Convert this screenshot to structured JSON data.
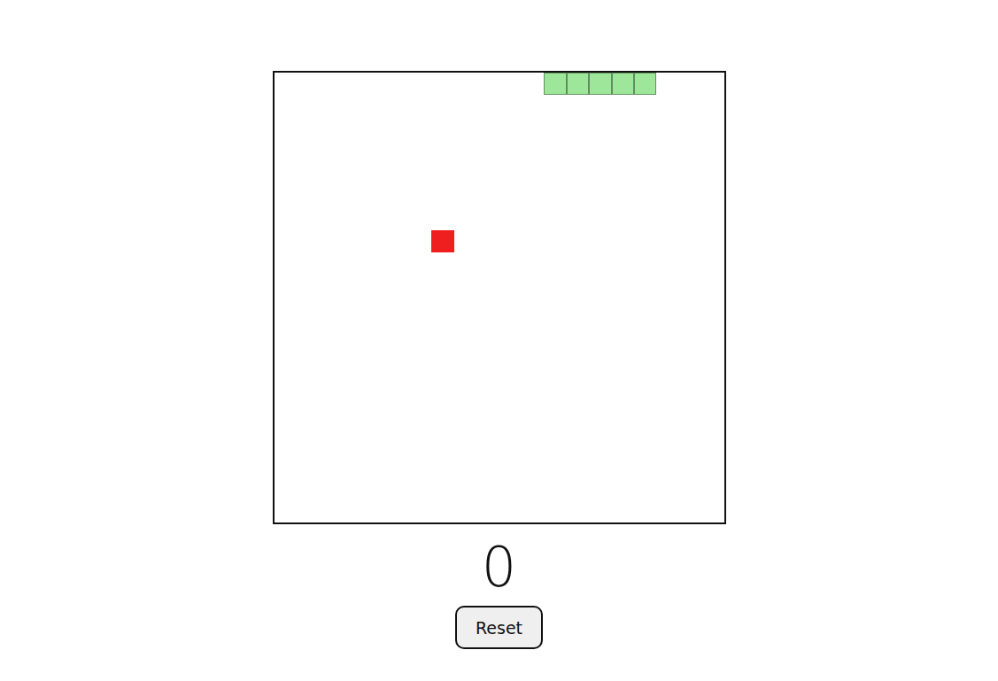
{
  "board": {
    "columns": 20,
    "rows": 20
  },
  "snake": [
    {
      "x": 12,
      "y": 0
    },
    {
      "x": 13,
      "y": 0
    },
    {
      "x": 14,
      "y": 0
    },
    {
      "x": 15,
      "y": 0
    },
    {
      "x": 16,
      "y": 0
    }
  ],
  "food": {
    "x": 7,
    "y": 7
  },
  "score": "0",
  "buttons": [
    "Reset"
  ]
}
